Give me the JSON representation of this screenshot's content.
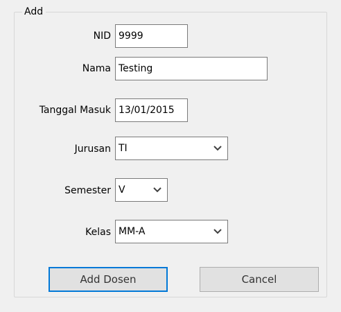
{
  "group": {
    "title": "Add"
  },
  "fields": {
    "nid": {
      "label": "NID",
      "value": "9999"
    },
    "nama": {
      "label": "Nama",
      "value": "Testing"
    },
    "tanggal_masuk": {
      "label": "Tanggal Masuk",
      "value": "13/01/2015"
    },
    "jurusan": {
      "label": "Jurusan",
      "value": "TI"
    },
    "semester": {
      "label": "Semester",
      "value": "V"
    },
    "kelas": {
      "label": "Kelas",
      "value": "MM-A"
    }
  },
  "buttons": {
    "add": "Add Dosen",
    "cancel": "Cancel"
  },
  "icons": {
    "dropdown": "chevron-down-icon"
  },
  "colors": {
    "background": "#f0f0f0",
    "focus_border": "#0078d7",
    "input_border": "#7a7a7a"
  }
}
